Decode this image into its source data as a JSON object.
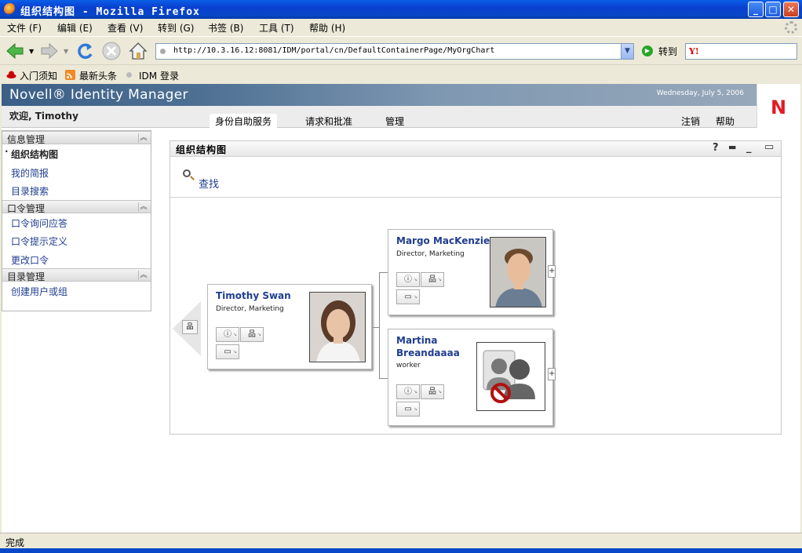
{
  "window": {
    "title": "组织结构图 - Mozilla Firefox",
    "controls": [
      "minimize",
      "maximize",
      "close"
    ]
  },
  "menubar": {
    "items": [
      "文件 (F)",
      "编辑 (E)",
      "查看 (V)",
      "转到 (G)",
      "书签 (B)",
      "工具 (T)",
      "帮助 (H)"
    ]
  },
  "navbar": {
    "url": "http://10.3.16.12:8081/IDM/portal/cn/DefaultContainerPage/MyOrgChart",
    "go_label": "转到",
    "search_engine": "Y!",
    "icons": [
      "back-icon",
      "forward-icon",
      "reload-icon",
      "stop-icon",
      "home-icon"
    ]
  },
  "bookmarks": {
    "items": [
      "入门须知",
      "最新头条",
      "IDM 登录"
    ]
  },
  "app": {
    "brand": "Novell® Identity Manager",
    "date": "Wednesday, July 5, 2006",
    "logo": "N",
    "welcome": "欢迎, Timothy",
    "tabs": [
      "身份自助服务",
      "请求和批准",
      "管理"
    ],
    "active_tab": "身份自助服务",
    "right_links": [
      "注销",
      "帮助"
    ]
  },
  "sidebar": {
    "sections": [
      {
        "title": "信息管理",
        "items": [
          "组织结构图",
          "我的简报",
          "目录搜索"
        ]
      },
      {
        "title": "口令管理",
        "items": [
          "口令询问应答",
          "口令提示定义",
          "更改口令"
        ]
      },
      {
        "title": "目录管理",
        "items": [
          "创建用户或组"
        ]
      }
    ],
    "current_item": "组织结构图"
  },
  "portlet": {
    "title": "组织结构图",
    "controls": [
      "?",
      "print",
      "minimize",
      "maximize"
    ],
    "find_label": "查找"
  },
  "orgchart": {
    "manager": {
      "name": "Timothy Swan",
      "title": "Director, Marketing"
    },
    "reports": [
      {
        "name": "Margo MacKenzie",
        "title": "Director, Marketing"
      },
      {
        "name_line1": "Martina",
        "name_line2": "Breandaaaa",
        "title": "worker"
      }
    ],
    "action_icons": [
      "info-icon",
      "orgchart-icon",
      "email-icon"
    ],
    "expand_symbol": "+"
  },
  "status": {
    "text": "完成"
  }
}
